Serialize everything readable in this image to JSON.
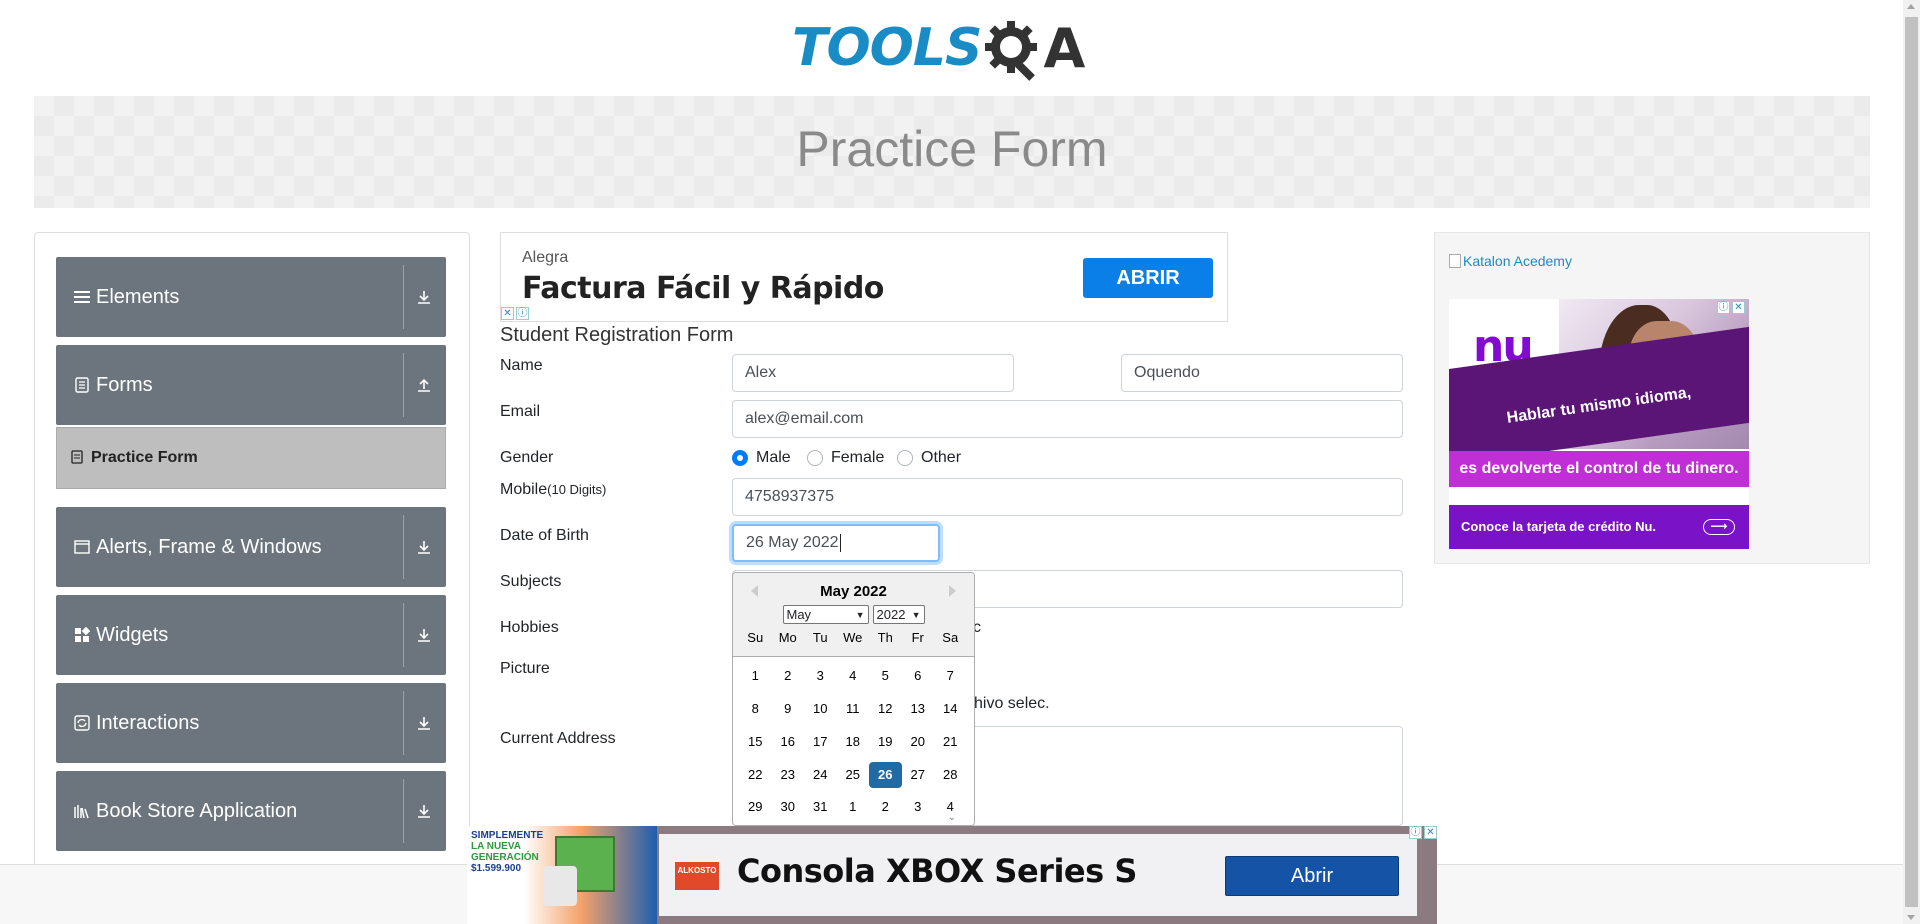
{
  "header": {
    "logo_text": "TOOLS",
    "logo_a": "A",
    "page_title": "Practice Form"
  },
  "sidebar": {
    "groups": [
      {
        "label": "Elements",
        "icon": "hamburger-icon",
        "arrow": "download-arrow-icon"
      },
      {
        "label": "Forms",
        "icon": "document-icon",
        "arrow": "upload-arrow-icon"
      },
      {
        "label": "Alerts, Frame & Windows",
        "icon": "window-icon",
        "arrow": "download-arrow-icon"
      },
      {
        "label": "Widgets",
        "icon": "widgets-icon",
        "arrow": "download-arrow-icon"
      },
      {
        "label": "Interactions",
        "icon": "interactions-icon",
        "arrow": "download-arrow-icon"
      },
      {
        "label": "Book Store Application",
        "icon": "books-icon",
        "arrow": "download-arrow-icon"
      }
    ],
    "active_item": {
      "label": "Practice Form",
      "icon": "form-icon"
    }
  },
  "ad_top": {
    "brand": "Alegra",
    "headline": "Factura Fácil y Rápido",
    "cta": "ABRIR",
    "close": "✕",
    "info": "ⓘ"
  },
  "form": {
    "title": "Student Registration Form",
    "labels": {
      "name": "Name",
      "email": "Email",
      "gender": "Gender",
      "mobile": "Mobile",
      "mobile_hint": "(10 Digits)",
      "dob": "Date of Birth",
      "subjects": "Subjects",
      "hobbies": "Hobbies",
      "picture": "Picture",
      "address": "Current Address"
    },
    "first_name": "Alex",
    "last_name": "Oquendo",
    "email": "alex@email.com",
    "gender_options": [
      "Male",
      "Female",
      "Other"
    ],
    "gender_selected": "Male",
    "mobile": "4758937375",
    "dob": "26 May 2022",
    "hobbies_partial": "c",
    "picture_partial": "hivo selec."
  },
  "calendar": {
    "header": "May 2022",
    "month_select": "May",
    "year_select": "2022",
    "weekdays": [
      "Su",
      "Mo",
      "Tu",
      "We",
      "Th",
      "Fr",
      "Sa"
    ],
    "weeks": [
      [
        "1",
        "2",
        "3",
        "4",
        "5",
        "6",
        "7"
      ],
      [
        "8",
        "9",
        "10",
        "11",
        "12",
        "13",
        "14"
      ],
      [
        "15",
        "16",
        "17",
        "18",
        "19",
        "20",
        "21"
      ],
      [
        "22",
        "23",
        "24",
        "25",
        "26",
        "27",
        "28"
      ],
      [
        "29",
        "30",
        "31",
        "1",
        "2",
        "3",
        "4"
      ]
    ],
    "selected_day": "26",
    "more_indicator": "⌄"
  },
  "ad_right": {
    "alt_text": "Katalon Acedemy",
    "nu_logo": "nu",
    "line1": "Hablar tu mismo idioma,",
    "line2": "es devolverte el control de tu dinero.",
    "footer": "Conoce la tarjeta de crédito Nu.",
    "arrow": "⟶",
    "info": "ⓘ",
    "close": "✕"
  },
  "ad_bottom": {
    "promo_line1": "SIMPLEMENTE",
    "promo_line2": "LA NUEVA GENERACIÓN",
    "promo_price": "$1.599.900",
    "store": "ALKOSTO",
    "title": "Consola XBOX Series S",
    "cta": "Abrir",
    "info": "ⓘ",
    "close": "✕"
  },
  "colors": {
    "brand_blue": "#1a8cc5",
    "sidebar_group": "#6c757d",
    "sidebar_active": "#bebebe",
    "radio_checked": "#007bff",
    "calendar_selected": "#216ba5",
    "ad_cta": "#0b7fe8",
    "nu_purple": "#820ad1"
  }
}
